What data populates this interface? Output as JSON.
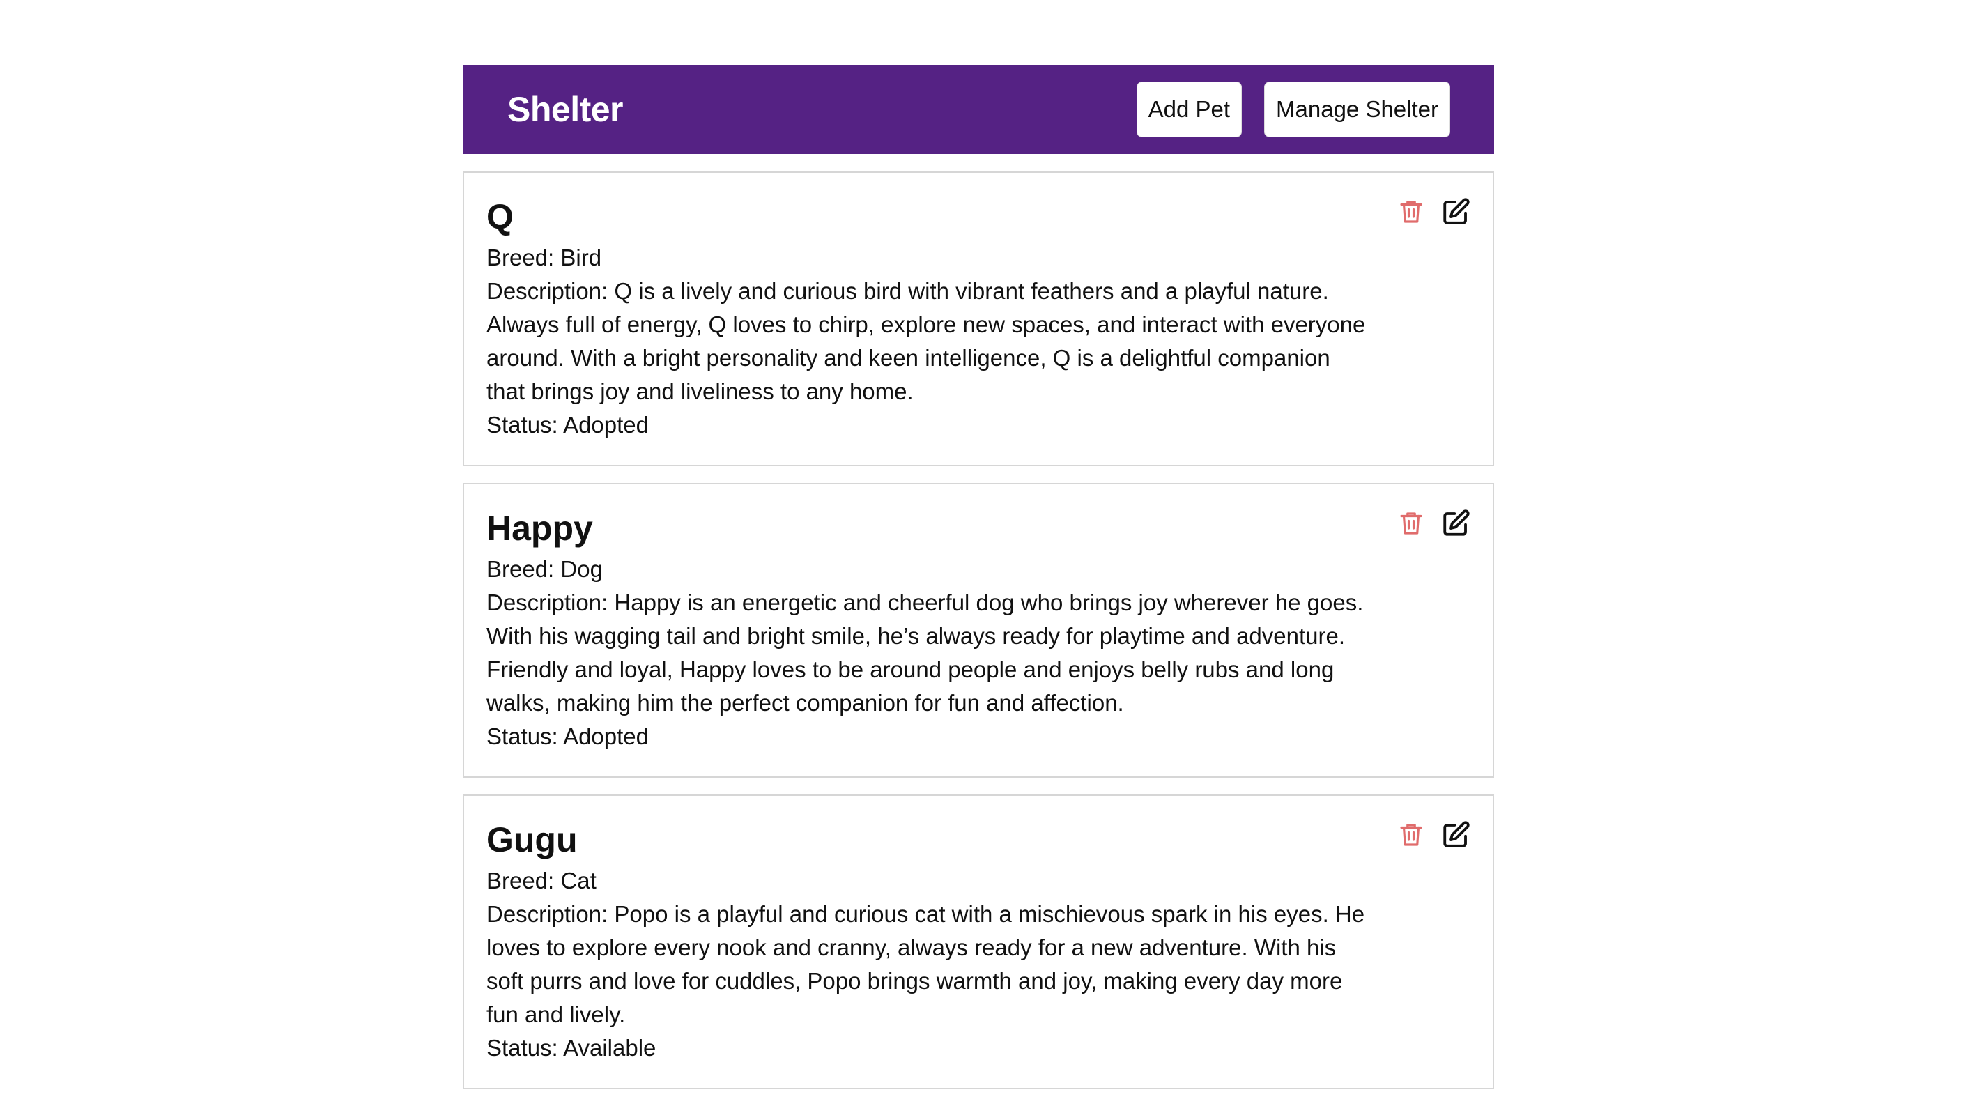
{
  "header": {
    "title": "Shelter",
    "add_pet_label": "Add Pet",
    "manage_label": "Manage Shelter"
  },
  "colors": {
    "header_bg": "#552284",
    "delete_icon": "#e06c6c",
    "edit_icon": "#111111"
  },
  "icons": {
    "delete": "trash-icon",
    "edit": "edit-icon"
  },
  "pets": [
    {
      "name": "Q",
      "breed": "Breed: Bird",
      "description": "Description: Q is a lively and curious bird with vibrant feathers and a playful nature. Always full of energy, Q loves to chirp, explore new spaces, and interact with everyone around. With a bright personality and keen intelligence, Q is a delightful companion that brings joy and liveliness to any home.",
      "status": "Status: Adopted"
    },
    {
      "name": "Happy",
      "breed": "Breed: Dog",
      "description": "Description: Happy is an energetic and cheerful dog who brings joy wherever he goes. With his wagging tail and bright smile, he’s always ready for playtime and adventure. Friendly and loyal, Happy loves to be around people and enjoys belly rubs and long walks, making him the perfect companion for fun and affection.",
      "status": "Status: Adopted"
    },
    {
      "name": "Gugu",
      "breed": "Breed: Cat",
      "description": "Description: Popo is a playful and curious cat with a mischievous spark in his eyes. He loves to explore every nook and cranny, always ready for a new adventure. With his soft purrs and love for cuddles, Popo brings warmth and joy, making every day more fun and lively.",
      "status": "Status: Available"
    }
  ]
}
